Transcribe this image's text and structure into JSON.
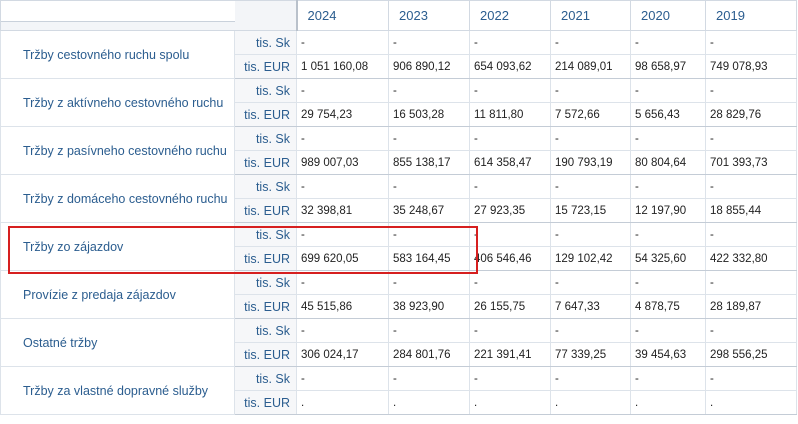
{
  "years": [
    "2024",
    "2023",
    "2022",
    "2021",
    "2020",
    "2019"
  ],
  "units": {
    "sk": "tis. Sk",
    "eur": "tis. EUR"
  },
  "rows": [
    {
      "label": "Tržby cestovného ruchu spolu",
      "sk": [
        "-",
        "-",
        "-",
        "-",
        "-",
        "-"
      ],
      "eur": [
        "1 051 160,08",
        "906 890,12",
        "654 093,62",
        "214 089,01",
        "98 658,97",
        "749 078,93"
      ]
    },
    {
      "label": "Tržby z aktívneho cestovného ruchu",
      "sk": [
        "-",
        "-",
        "-",
        "-",
        "-",
        "-"
      ],
      "eur": [
        "29 754,23",
        "16 503,28",
        "11 811,80",
        "7 572,66",
        "5 656,43",
        "28 829,76"
      ]
    },
    {
      "label": "Tržby z pasívneho cestovného ruchu",
      "sk": [
        "-",
        "-",
        "-",
        "-",
        "-",
        "-"
      ],
      "eur": [
        "989 007,03",
        "855 138,17",
        "614 358,47",
        "190 793,19",
        "80 804,64",
        "701 393,73"
      ]
    },
    {
      "label": "Tržby z domáceho cestovného ruchu",
      "sk": [
        "-",
        "-",
        "-",
        "-",
        "-",
        "-"
      ],
      "eur": [
        "32 398,81",
        "35 248,67",
        "27 923,35",
        "15 723,15",
        "12 197,90",
        "18 855,44"
      ]
    },
    {
      "label": "Tržby zo zájazdov",
      "sk": [
        "-",
        "-",
        "-",
        "-",
        "-",
        "-"
      ],
      "eur": [
        "699 620,05",
        "583 164,45",
        "406 546,46",
        "129 102,42",
        "54 325,60",
        "422 332,80"
      ]
    },
    {
      "label": "Provízie z predaja zájazdov",
      "sk": [
        "-",
        "-",
        "-",
        "-",
        "-",
        "-"
      ],
      "eur": [
        "45 515,86",
        "38 923,90",
        "26 155,75",
        "7 647,33",
        "4 878,75",
        "28 189,87"
      ]
    },
    {
      "label": "Ostatné tržby",
      "sk": [
        "-",
        "-",
        "-",
        "-",
        "-",
        "-"
      ],
      "eur": [
        "306 024,17",
        "284 801,76",
        "221 391,41",
        "77 339,25",
        "39 454,63",
        "298 556,25"
      ]
    },
    {
      "label": "Tržby za vlastné dopravné služby",
      "sk": [
        "-",
        "-",
        "-",
        "-",
        "-",
        "-"
      ],
      "eur": [
        ".",
        ".",
        ".",
        ".",
        ".",
        "."
      ]
    }
  ],
  "highlight": {
    "row_label": "Tržby zo zájazdov",
    "color": "#d61f1f"
  }
}
